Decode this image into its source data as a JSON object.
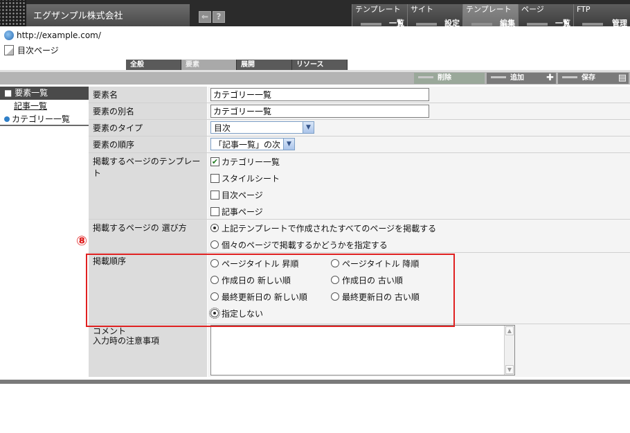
{
  "header": {
    "company_name": "エグザンプル株式会社",
    "icons": [
      "back-icon",
      "help-icon"
    ],
    "help_glyph": "?",
    "menus": [
      {
        "top": "テンプレート",
        "bottom": "一覧",
        "active": false
      },
      {
        "top": "サイト",
        "bottom": "設定",
        "active": false
      },
      {
        "top": "テンプレート",
        "bottom": "編集",
        "active": true
      },
      {
        "top": "ページ",
        "bottom": "一覧",
        "active": false
      },
      {
        "top": "FTP",
        "bottom": "管理",
        "active": false
      }
    ]
  },
  "location": {
    "url": "http://example.com/",
    "page": "目次ページ"
  },
  "tabs": [
    {
      "label": "全般",
      "active": false
    },
    {
      "label": "要素",
      "active": true
    },
    {
      "label": "展開",
      "active": false
    },
    {
      "label": "リソース",
      "active": false
    }
  ],
  "actions": {
    "delete": "削除",
    "add": "追加",
    "save": "保存"
  },
  "sidebar": {
    "header": "要素一覧",
    "items": [
      {
        "label": "記事一覧",
        "selected": false
      },
      {
        "label": "カテゴリー一覧",
        "selected": true
      }
    ]
  },
  "form": {
    "name_label": "要素名",
    "name_value": "カテゴリー一覧",
    "alias_label": "要素の別名",
    "alias_value": "カテゴリー一覧",
    "type_label": "要素のタイプ",
    "type_value": "目次",
    "order_label": "要素の順序",
    "order_value": "「記事一覧」の次",
    "templates_label": "掲載するページのテンプレート",
    "templates": [
      {
        "label": "カテゴリー一覧",
        "checked": true
      },
      {
        "label": "スタイルシート",
        "checked": false
      },
      {
        "label": "目次ページ",
        "checked": false
      },
      {
        "label": "記事ページ",
        "checked": false
      }
    ],
    "select_label": "掲載するページの 選び方",
    "select_options": [
      {
        "label": "上記テンプレートで作成されたすべてのページを掲載する",
        "selected": true
      },
      {
        "label": "個々のページで掲載するかどうかを指定する",
        "selected": false
      }
    ],
    "sort_label": "掲載順序",
    "sort_options": [
      {
        "label": "ページタイトル 昇順",
        "selected": false
      },
      {
        "label": "ページタイトル 降順",
        "selected": false
      },
      {
        "label": "作成日の 新しい順",
        "selected": false
      },
      {
        "label": "作成日の 古い順",
        "selected": false
      },
      {
        "label": "最終更新日の 新しい順",
        "selected": false
      },
      {
        "label": "最終更新日の 古い順",
        "selected": false
      },
      {
        "label": "指定しない",
        "selected": true
      }
    ],
    "comment_label_1": "コメント",
    "comment_label_2": "入力時の注意事項",
    "comment_value": ""
  },
  "annotation": {
    "marker": "⑧",
    "color": "#e02020"
  }
}
